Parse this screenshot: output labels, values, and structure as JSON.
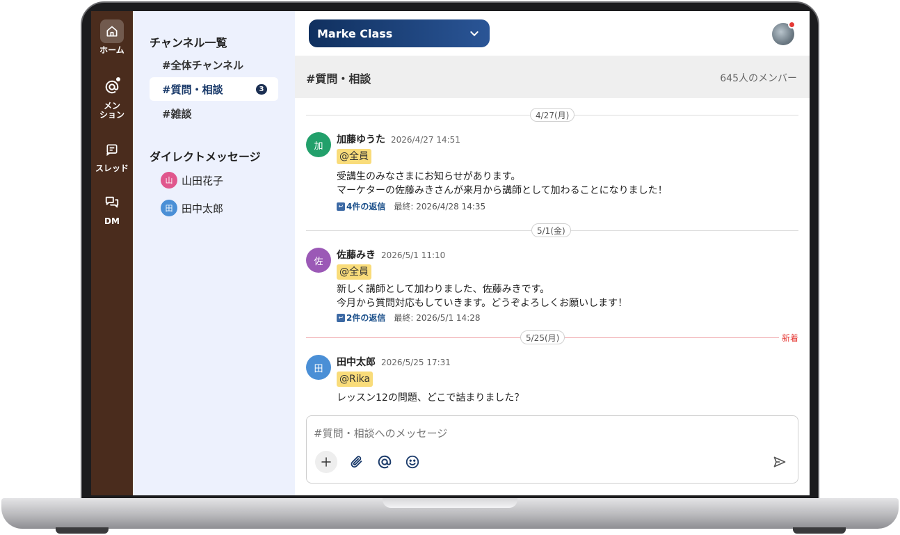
{
  "rail": {
    "home_label": "ホーム",
    "mention_label_line1": "メン",
    "mention_label_line2": "ション",
    "threads_label": "スレッド",
    "dm_label": "DM"
  },
  "sidebar": {
    "channels_title": "チャンネル一覧",
    "channels": [
      {
        "label": "#全体チャンネル",
        "active": false
      },
      {
        "label": "#質問・相談",
        "active": true,
        "badge": "3"
      },
      {
        "label": "#雑談",
        "active": false
      }
    ],
    "dm_title": "ダイレクトメッセージ",
    "dms": [
      {
        "initial": "山",
        "name": "山田花子",
        "color": "#e0578d"
      },
      {
        "initial": "田",
        "name": "田中太郎",
        "color": "#4a8fd6"
      }
    ]
  },
  "topbar": {
    "class_name": "Marke Class"
  },
  "channel_header": {
    "name": "#質問・相談",
    "members": "645人のメンバー"
  },
  "dates": {
    "d1": "4/27(月)",
    "d2": "5/1(金)",
    "d3": "5/25(月)",
    "new_label": "新着"
  },
  "messages": [
    {
      "initial": "加",
      "color": "#22a06b",
      "author": "加藤ゆうた",
      "time": "2026/4/27 14:51",
      "mention": "@全員",
      "line1": "受講生のみなさまにお知らせがあります。",
      "line2": "マーケターの佐藤みきさんが来月から講師として加わることになりました！",
      "reply_count": "4件の返信",
      "reply_last": "最終: 2026/4/28 14:35"
    },
    {
      "initial": "佐",
      "color": "#9b59b6",
      "author": "佐藤みき",
      "time": "2026/5/1 11:10",
      "mention": "@全員",
      "line1": "新しく講師として加わりました、佐藤みきです。",
      "line2": "今月から質問対応もしていきます。どうぞよろしくお願いします！",
      "reply_count": "2件の返信",
      "reply_last": "最終: 2026/5/1 14:28"
    },
    {
      "initial": "田",
      "color": "#4a8fd6",
      "author": "田中太郎",
      "time": "2026/5/25 17:31",
      "mention": "@Rika",
      "line1": "レッスン12の問題、どこで詰まりました？"
    }
  ],
  "composer": {
    "placeholder": "#質問・相談へのメッセージ"
  },
  "colors": {
    "rail": "#4a2c1d",
    "sidebar": "#edf1fd",
    "accent": "#10305f",
    "mention_bg": "#f9dc7a",
    "new_divider": "#e53935"
  }
}
